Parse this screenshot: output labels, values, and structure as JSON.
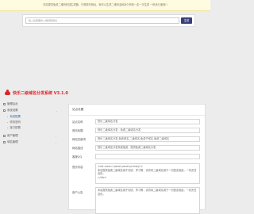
{
  "notice": {
    "text": "本站提供免费二维码在线生成器，只需填写网址，就可以生成二维码活码永久有效一定一次生成 一码永久使用!!"
  },
  "search": {
    "placeholder": "输入您需要的二维码短网址",
    "button_label": "生成"
  },
  "brand": {
    "title": "快乐二级域名分发系统 V3.1.0",
    "accent_color": "#d9262b"
  },
  "sidebar": {
    "items": [
      {
        "label": "管理后台",
        "icon": "home-icon",
        "kind": "top"
      },
      {
        "label": "系统设置",
        "icon": "settings-icon",
        "kind": "top"
      },
      {
        "label": "系统配置",
        "kind": "sub",
        "active": true
      },
      {
        "label": "修改密码",
        "kind": "sub"
      },
      {
        "label": "接口配置",
        "kind": "sub"
      },
      {
        "label": "用户管理",
        "icon": "user-icon",
        "kind": "top"
      },
      {
        "label": "域名管理",
        "icon": "domain-icon",
        "kind": "top"
      }
    ]
  },
  "settings": {
    "panel_title": "站点设置",
    "fields": [
      {
        "label": "站点名称",
        "value": "快乐二级域名分发"
      },
      {
        "label": "首页标题",
        "value": "快乐二级域名分发 - 免费二级域名分发"
      },
      {
        "label": "网站关键词",
        "value": "快乐二级域名分发,免费域名,二级域名,免费子域名,免费二级域名"
      },
      {
        "label": "网站描述",
        "value": "快乐二级域名分发系统免费，提供免费二级域名分发"
      },
      {
        "label": "客服QQ",
        "value": ""
      },
      {
        "label": "首页内容",
        "value": "<div class=\"panel panel-primary\">\n本站提供免费二级域名用于测试、学习等，请勿将二级域名用于一切违法用途，一切责任自负。\n</div>"
      },
      {
        "label": "用户公告",
        "value": "本站提供免费二级域名用于测试、学习等，请勿将二级域名用于一切违法用途，一切责任自负。"
      }
    ]
  }
}
